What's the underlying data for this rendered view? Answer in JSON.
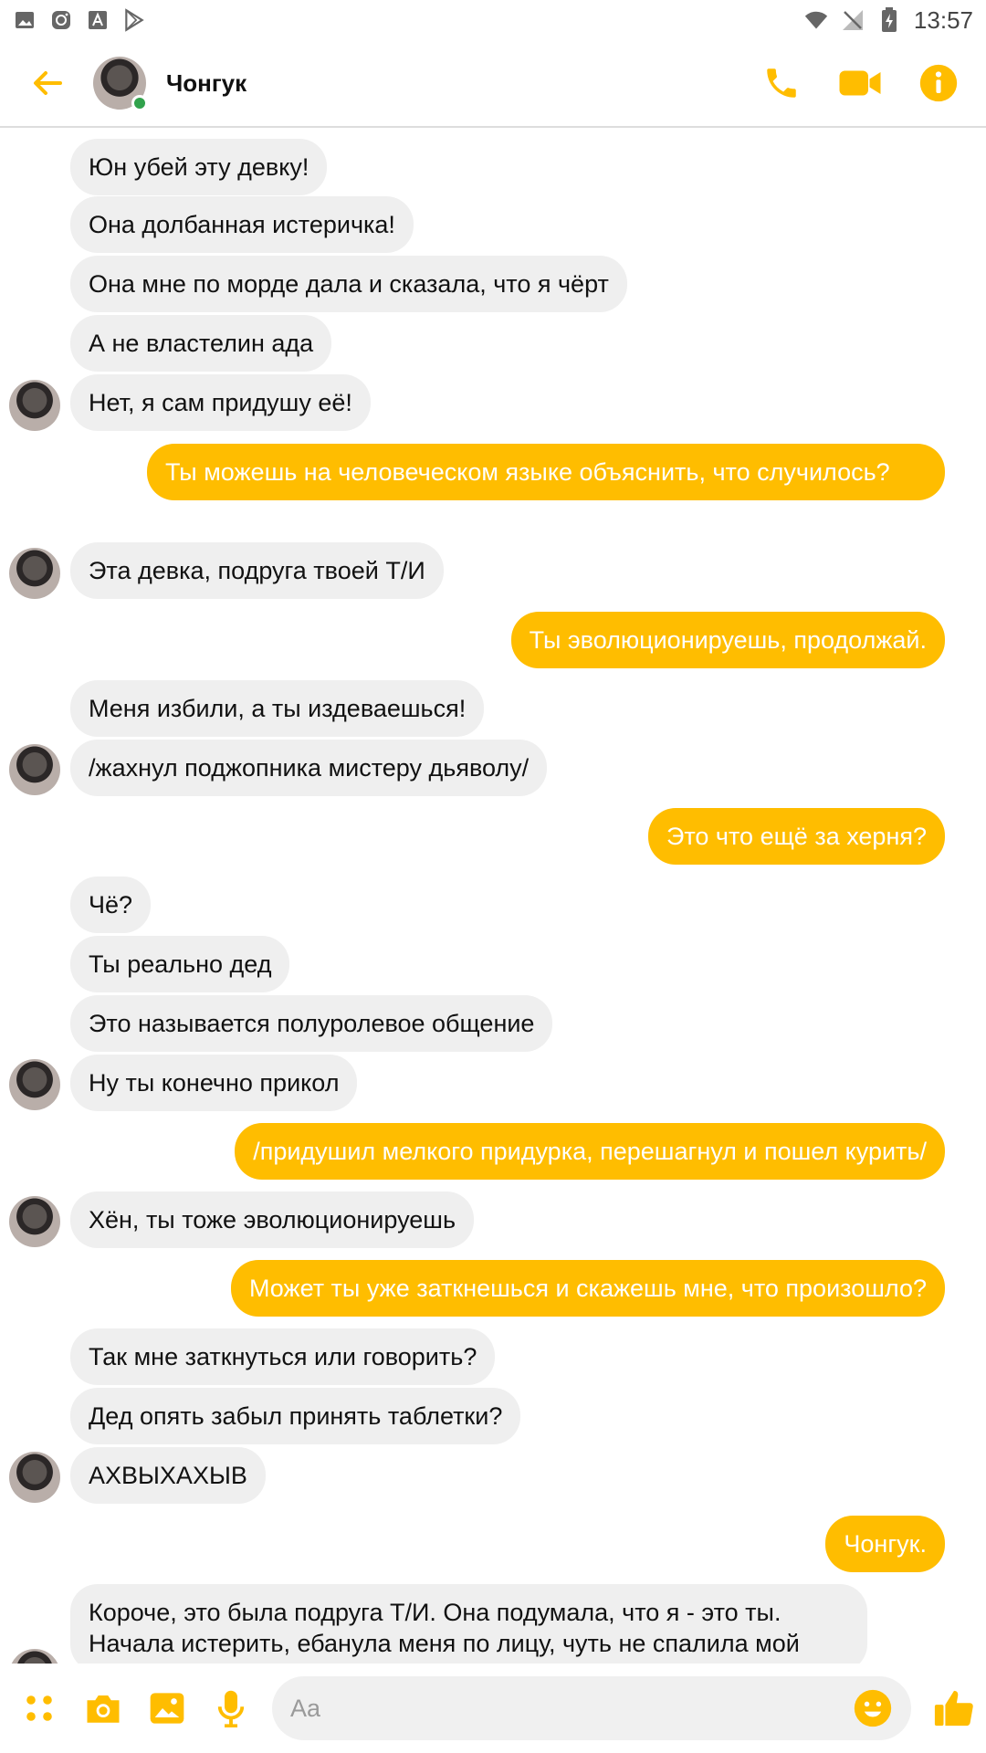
{
  "status_bar": {
    "time": "13:57"
  },
  "colors": {
    "accent": "#ffbd00",
    "incoming_bubble": "#efefef",
    "online": "#31a24c"
  },
  "header": {
    "contact_name": "Чонгук"
  },
  "messages": [
    {
      "dir": "in",
      "text": "Юн убей эту девку!"
    },
    {
      "dir": "in",
      "text": "Она долбанная истеричка!"
    },
    {
      "dir": "in",
      "text": "Она мне по морде дала и сказала, что я чёрт"
    },
    {
      "dir": "in",
      "text": "А не властелин ада"
    },
    {
      "dir": "in",
      "text": "Нет, я сам придушу её!"
    },
    {
      "dir": "out",
      "text": "Ты можешь на человеческом языке объяснить, что случилось?"
    },
    {
      "dir": "in",
      "text": "Эта девка, подруга твоей Т/И"
    },
    {
      "dir": "out",
      "text": "Ты эволюционируешь, продолжай."
    },
    {
      "dir": "in",
      "text": "Меня избили, а ты издеваешься!"
    },
    {
      "dir": "in",
      "text": "/жахнул поджопника мистеру дьяволу/"
    },
    {
      "dir": "out",
      "text": "Это что ещё за херня?"
    },
    {
      "dir": "in",
      "text": "Чё?"
    },
    {
      "dir": "in",
      "text": "Ты реально дед"
    },
    {
      "dir": "in",
      "text": "Это называется полуролевое общение"
    },
    {
      "dir": "in",
      "text": "Ну ты конечно прикол"
    },
    {
      "dir": "out",
      "text": "/придушил мелкого придурка, перешагнул и пошел курить/"
    },
    {
      "dir": "in",
      "text": "Хён, ты тоже эволюционируешь"
    },
    {
      "dir": "out",
      "text": "Может ты уже заткнешься и скажешь мне, что произошло?"
    },
    {
      "dir": "in",
      "text": "Так мне заткнуться или говорить?"
    },
    {
      "dir": "in",
      "text": "Дед опять забыл принять таблетки?"
    },
    {
      "dir": "in",
      "text": "АХВЫХАХЫВ"
    },
    {
      "dir": "out",
      "text": "Чонгук."
    },
    {
      "dir": "in",
      "text": "Короче, это была подруга Т/И. Она подумала, что я - это ты. Начала истерить, ебанула меня по лицу, чуть не спалила мой"
    }
  ],
  "composer": {
    "placeholder": "Aa"
  }
}
